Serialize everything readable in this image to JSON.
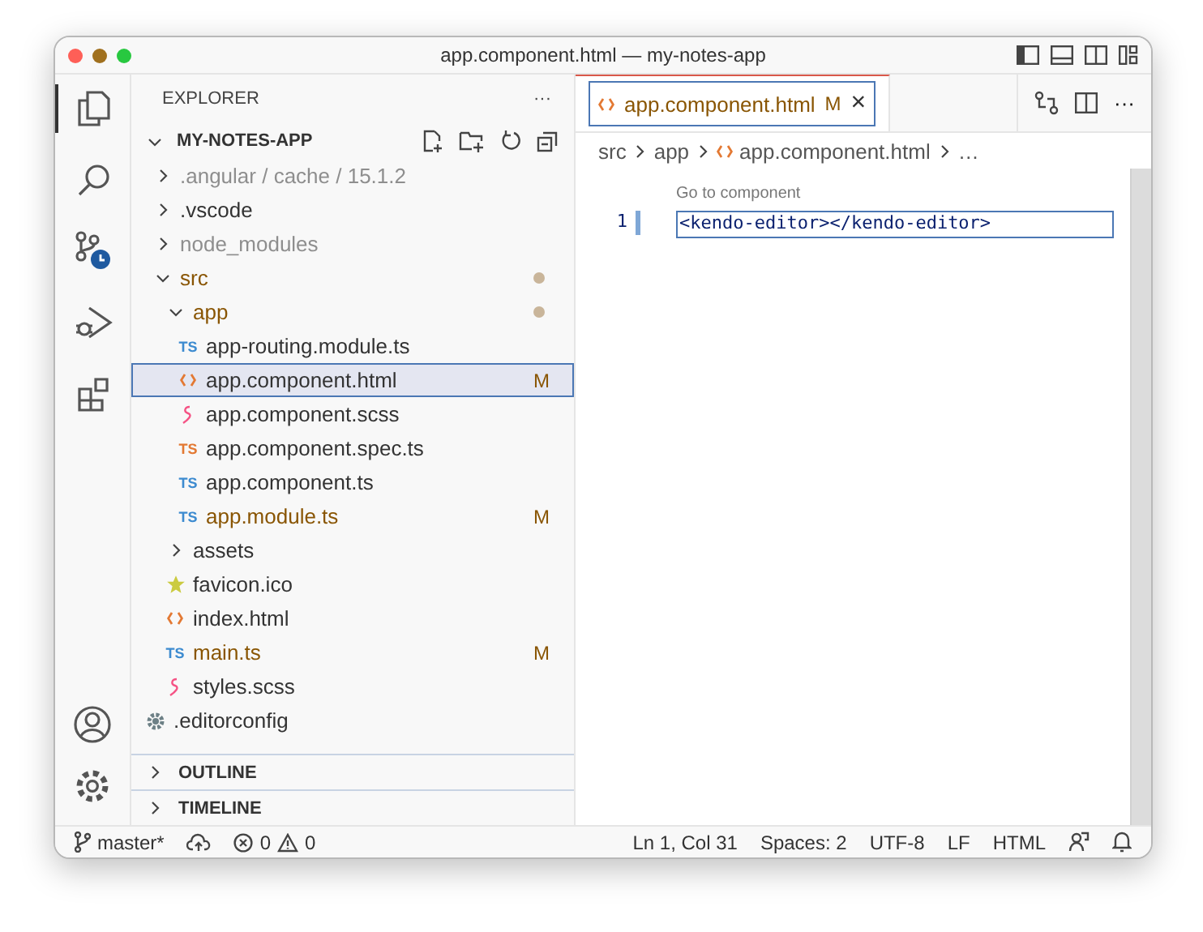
{
  "window": {
    "title": "app.component.html — my-notes-app"
  },
  "activity_bar": [
    {
      "kind": "files",
      "selected": true
    },
    {
      "kind": "search",
      "selected": false
    },
    {
      "kind": "source-control",
      "selected": false
    },
    {
      "kind": "debug",
      "selected": false
    },
    {
      "kind": "extensions",
      "selected": false
    }
  ],
  "sidebar": {
    "title": "EXPLORER",
    "more": "···",
    "root": {
      "label": "MY-NOTES-APP",
      "expanded": true
    },
    "tree": [
      {
        "name": ".angular / cache / 15.1.2",
        "kind": "folder",
        "expanded": false,
        "ignored": true,
        "modified": false,
        "selected": false
      },
      {
        "name": ".vscode",
        "kind": "folder",
        "expanded": false,
        "ignored": false,
        "modified": false,
        "selected": false
      },
      {
        "name": "node_modules",
        "kind": "folder",
        "expanded": false,
        "ignored": true,
        "modified": false,
        "selected": false
      },
      {
        "name": "src",
        "kind": "folder",
        "expanded": true,
        "ignored": false,
        "modified": true,
        "has_changes": true,
        "selected": false,
        "children": [
          {
            "name": "app",
            "kind": "folder",
            "expanded": true,
            "ignored": false,
            "modified": true,
            "has_changes": true,
            "selected": false,
            "children": [
              {
                "name": "app-routing.module.ts",
                "kind": "ts",
                "badge": "TS",
                "ignored": false,
                "modified": false,
                "selected": false
              },
              {
                "name": "app.component.html",
                "kind": "html",
                "ignored": false,
                "modified": false,
                "status": "M",
                "selected": true
              },
              {
                "name": "app.component.scss",
                "kind": "scss",
                "ignored": false,
                "modified": false,
                "selected": false
              },
              {
                "name": "app.component.spec.ts",
                "kind": "spec",
                "badge": "TS",
                "ignored": false,
                "modified": false,
                "selected": false
              },
              {
                "name": "app.component.ts",
                "kind": "ts",
                "badge": "TS",
                "ignored": false,
                "modified": false,
                "selected": false
              },
              {
                "name": "app.module.ts",
                "kind": "ts",
                "badge": "TS",
                "ignored": false,
                "modified": true,
                "status": "M",
                "selected": false
              }
            ]
          },
          {
            "name": "assets",
            "kind": "folder",
            "expanded": false,
            "ignored": false,
            "modified": false,
            "selected": false
          },
          {
            "name": "favicon.ico",
            "kind": "image",
            "ignored": false,
            "modified": false,
            "selected": false
          },
          {
            "name": "index.html",
            "kind": "html",
            "ignored": false,
            "modified": false,
            "selected": false
          },
          {
            "name": "main.ts",
            "kind": "ts",
            "badge": "TS",
            "ignored": false,
            "modified": true,
            "status": "M",
            "selected": false
          },
          {
            "name": "styles.scss",
            "kind": "scss",
            "ignored": false,
            "modified": false,
            "selected": false
          }
        ]
      },
      {
        "name": ".editorconfig",
        "kind": "config",
        "ignored": false,
        "modified": false,
        "selected": false
      }
    ],
    "panels": [
      {
        "label": "OUTLINE",
        "expanded": false
      },
      {
        "label": "TIMELINE",
        "expanded": false
      }
    ]
  },
  "editor": {
    "tabs": [
      {
        "label": "app.component.html",
        "status": "M",
        "close": "×",
        "selected": true
      }
    ],
    "more": "···",
    "breadcrumbs": [
      "src",
      "app",
      "app.component.html",
      "…"
    ],
    "codelens": "Go to component",
    "lines": [
      {
        "number": "1",
        "code": "<kendo-editor></kendo-editor>"
      }
    ]
  },
  "status_bar": {
    "branch": "master*",
    "errors": "0",
    "warnings": "0",
    "right": [
      "Ln 1, Col 31",
      "Spaces: 2",
      "UTF-8",
      "LF",
      "HTML"
    ]
  }
}
